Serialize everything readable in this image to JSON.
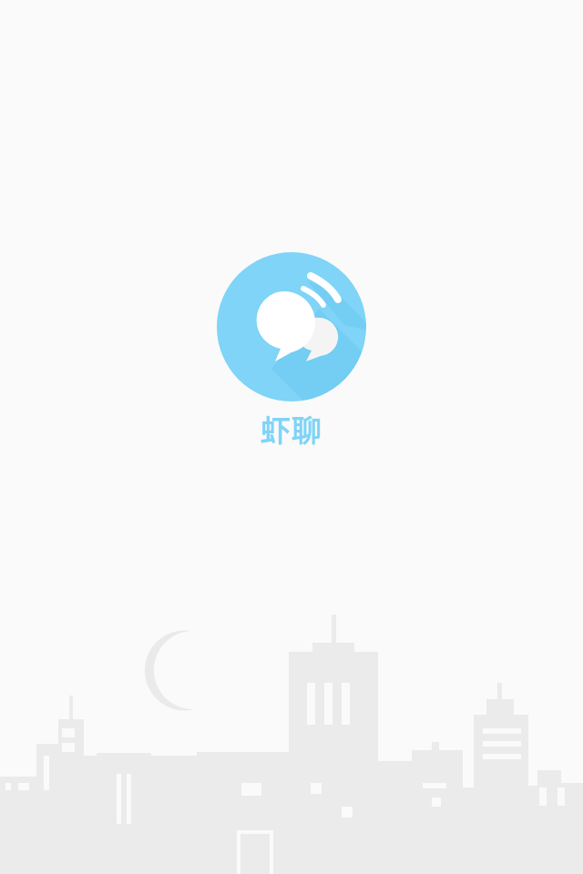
{
  "splash": {
    "app_name": "虾聊",
    "logo_icon": "chat-bubbles-icon",
    "background_art": "night-city-skyline"
  },
  "colors": {
    "background": "#fafafa",
    "brand": "#7fd4f7",
    "skyline": "#ececec"
  }
}
